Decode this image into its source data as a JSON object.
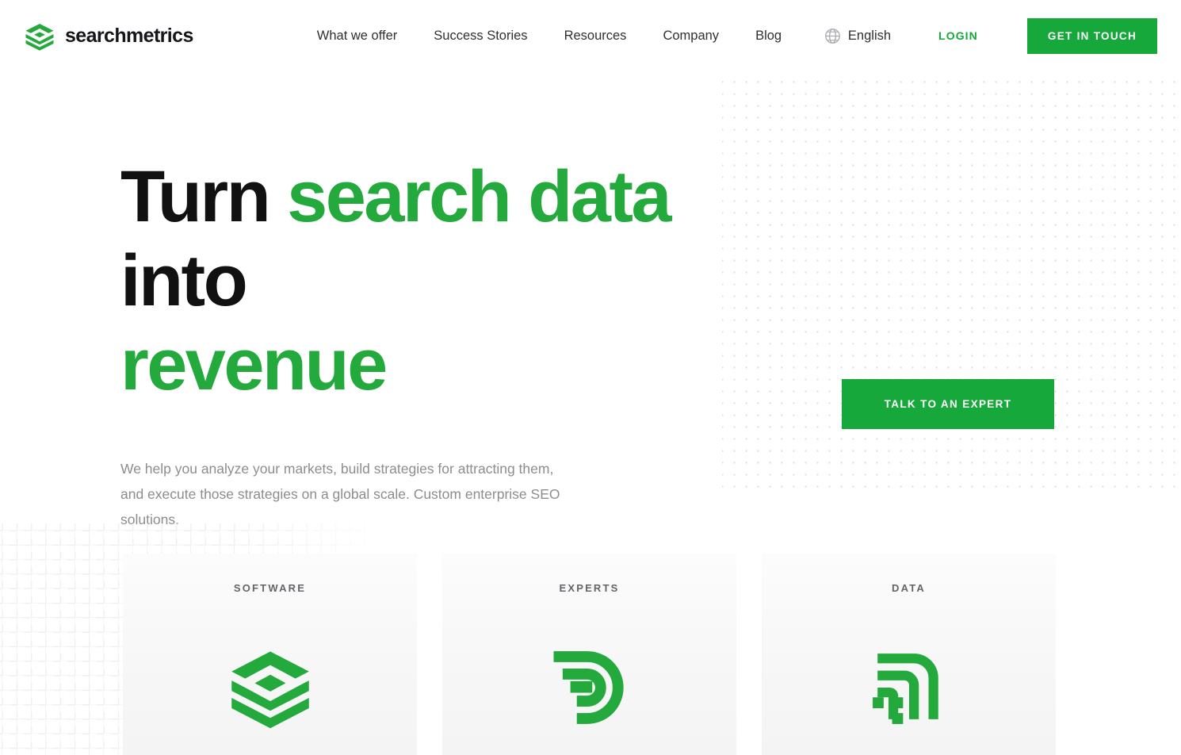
{
  "brand": {
    "name": "searchmetrics",
    "logo_icon": "stacked-layers-logo-icon",
    "accent_color": "#16a83a",
    "title_green": "#23a93c"
  },
  "header": {
    "nav_items": [
      {
        "label": "What we offer"
      },
      {
        "label": "Success Stories"
      },
      {
        "label": "Resources"
      },
      {
        "label": "Company"
      },
      {
        "label": "Blog"
      }
    ],
    "language": {
      "icon": "globe-icon",
      "label": "English"
    },
    "login_label": "LOGIN",
    "cta_label": "GET IN TOUCH"
  },
  "hero": {
    "title_part_1": "Turn ",
    "title_part_2": "search data",
    "title_part_3": " into",
    "title_part_4": "revenue",
    "subtitle": "We help you analyze your markets, build strategies for attracting them, and execute those strategies on a global scale. Custom enterprise SEO solutions.",
    "expert_button_label": "TALK TO AN EXPERT"
  },
  "cards": [
    {
      "label": "SOFTWARE",
      "icon": "stacked-layers-icon"
    },
    {
      "label": "EXPERTS",
      "icon": "concentric-d-arcs-icon"
    },
    {
      "label": "DATA",
      "icon": "nested-signal-brackets-icon"
    }
  ]
}
